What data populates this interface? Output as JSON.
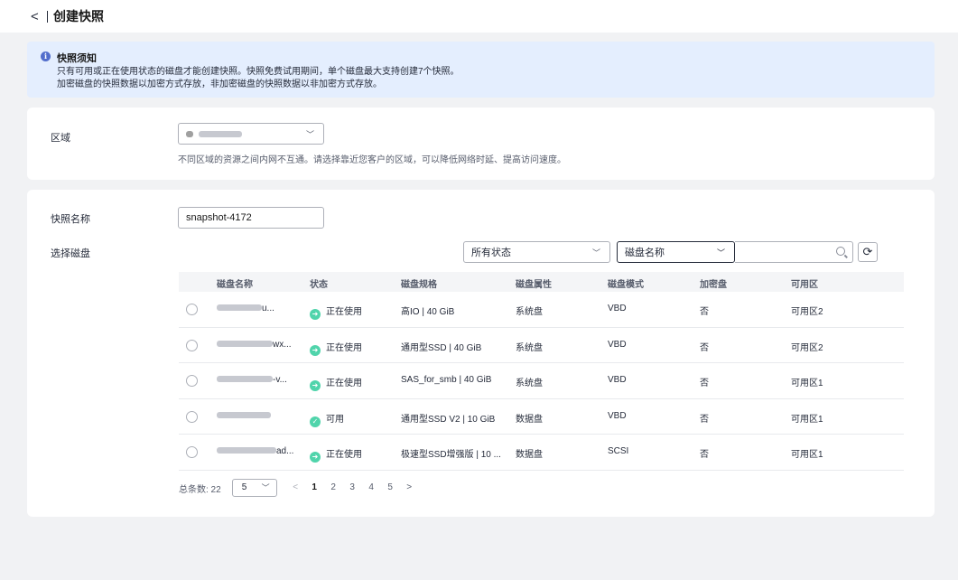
{
  "header": {
    "back_icon": "chevron-left-icon",
    "back_glyph": "<",
    "title": "创建快照"
  },
  "notice": {
    "icon": "info-icon",
    "title": "快照须知",
    "line1": "只有可用或正在使用状态的磁盘才能创建快照。快照免费试用期间，单个磁盘最大支持创建7个快照。",
    "line2": "加密磁盘的快照数据以加密方式存放，非加密磁盘的快照数据以非加密方式存放。"
  },
  "region": {
    "label": "区域",
    "hint": "不同区域的资源之间内网不互通。请选择靠近您客户的区域，可以降低网络时延、提高访问速度。"
  },
  "snapshot_name": {
    "label": "快照名称",
    "value": "snapshot-4172"
  },
  "disk_select": {
    "label": "选择磁盘",
    "status_filter": "所有状态",
    "search_field": "磁盘名称",
    "search_value": ""
  },
  "table": {
    "headers": [
      "磁盘名称",
      "状态",
      "磁盘规格",
      "磁盘属性",
      "磁盘模式",
      "加密盘",
      "可用区"
    ],
    "rows": [
      {
        "name_suffix": "u...",
        "status": "正在使用",
        "status_type": "in-use",
        "spec": "高IO | 40 GiB",
        "attr": "系统盘",
        "mode": "VBD",
        "encrypted": "否",
        "az": "可用区2"
      },
      {
        "name_suffix": "wx...",
        "status": "正在使用",
        "status_type": "in-use",
        "spec": "通用型SSD | 40 GiB",
        "attr": "系统盘",
        "mode": "VBD",
        "encrypted": "否",
        "az": "可用区2"
      },
      {
        "name_suffix": "-v...",
        "status": "正在使用",
        "status_type": "in-use",
        "spec": "SAS_for_smb | 40 GiB",
        "attr": "系统盘",
        "mode": "VBD",
        "encrypted": "否",
        "az": "可用区1"
      },
      {
        "name_suffix": "",
        "status": "可用",
        "status_type": "available",
        "spec": "通用型SSD V2 | 10 GiB",
        "attr": "数据盘",
        "mode": "VBD",
        "encrypted": "否",
        "az": "可用区1"
      },
      {
        "name_suffix": "ad...",
        "status": "正在使用",
        "status_type": "in-use",
        "spec": "极速型SSD增强版 | 10 ...",
        "attr": "数据盘",
        "mode": "SCSI",
        "encrypted": "否",
        "az": "可用区1"
      }
    ]
  },
  "pagination": {
    "total": "总条数: 22",
    "page_size": "5",
    "pages": [
      "1",
      "2",
      "3",
      "4",
      "5"
    ],
    "current": "1",
    "prev_glyph": "<",
    "next_glyph": ">"
  },
  "colors": {
    "accent": "#526ecc",
    "status_green": "#50d4ab",
    "notice_bg": "#e4eefe"
  }
}
